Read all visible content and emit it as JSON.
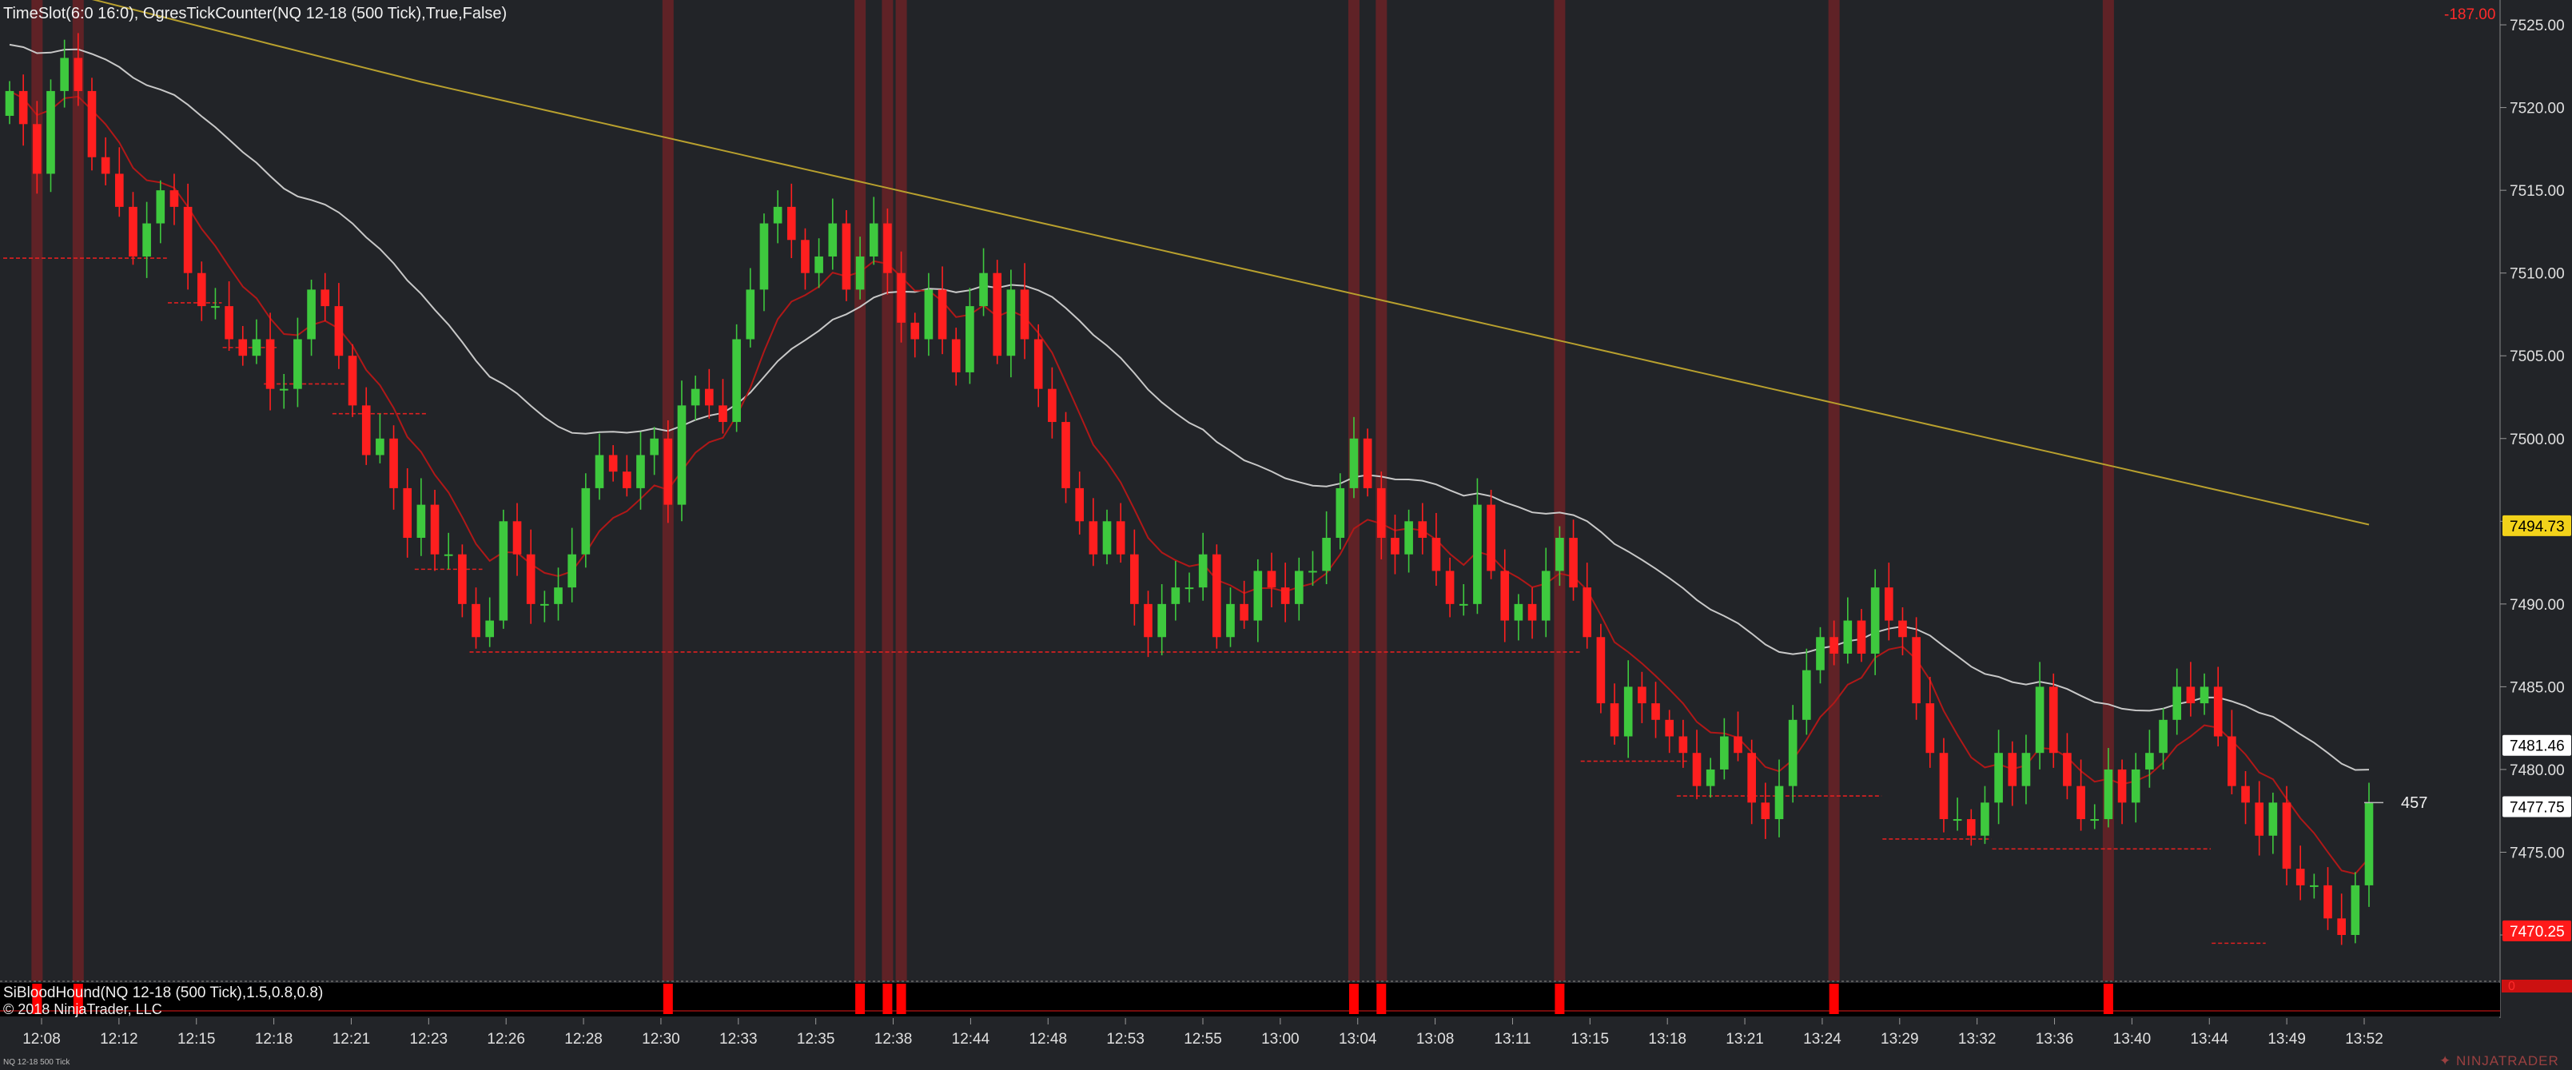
{
  "header": {
    "indicator_label": "TimeSlot(6:0    16:0), OgresTickCounter(NQ 12-18 (500 Tick),True,False)",
    "pnl": "-187.00",
    "tick_counter": "457"
  },
  "sub_panel": {
    "label": "SiBloodHound(NQ 12-18 (500 Tick),1.5,0.8,0.8)",
    "copyright": "© 2018 NinjaTrader, LLC",
    "zero_label": "0"
  },
  "footer": {
    "instrument": "NQ 12-18 500 Tick",
    "logo": "NINJATRADER"
  },
  "price_badges": [
    {
      "value": "7494.73",
      "price": 7494.73,
      "bg": "#f2d21a",
      "fg": "#000000"
    },
    {
      "value": "7481.46",
      "price": 7481.46,
      "bg": "#ffffff",
      "fg": "#000000"
    },
    {
      "value": "7477.75",
      "price": 7477.75,
      "bg": "#ffffff",
      "fg": "#000000"
    },
    {
      "value": "7470.25",
      "price": 7470.25,
      "bg": "#ff1a1a",
      "fg": "#ffffff"
    }
  ],
  "colors": {
    "background": "#222428",
    "up_candle": "#3ec93e",
    "down_candle": "#ff1f1f",
    "sma_slow": "#b8a02e",
    "sma_mid": "#c8c8c8",
    "ema_fast": "#b01818",
    "signal_band": "#6a2226",
    "signal_bar": "#ff0000"
  },
  "chart_data": {
    "type": "candlestick",
    "instrument": "NQ 12-18 (500 Tick)",
    "y_ticks": [
      7470.0,
      7475.0,
      7480.0,
      7485.0,
      7490.0,
      7495.0,
      7500.0,
      7505.0,
      7510.0,
      7515.0,
      7520.0,
      7525.0
    ],
    "ylim": [
      7467.2,
      7526.5
    ],
    "x_tick_labels": [
      "12:08",
      "12:12",
      "12:15",
      "12:18",
      "12:21",
      "12:23",
      "12:26",
      "12:28",
      "12:30",
      "12:33",
      "12:35",
      "12:38",
      "12:44",
      "12:48",
      "12:53",
      "12:55",
      "13:00",
      "13:04",
      "13:08",
      "13:11",
      "13:15",
      "13:18",
      "13:21",
      "13:24",
      "13:29",
      "13:32",
      "13:36",
      "13:40",
      "13:44",
      "13:49",
      "13:52"
    ],
    "closes": [
      7521,
      7519,
      7516,
      7521,
      7523,
      7521,
      7517,
      7516,
      7514,
      7511,
      7513,
      7515,
      7514,
      7510,
      7508,
      7508,
      7506,
      7505,
      7506,
      7503,
      7503,
      7506,
      7509,
      7508,
      7505,
      7502,
      7499,
      7500,
      7497,
      7494,
      7496,
      7493,
      7493,
      7490,
      7488,
      7489,
      7495,
      7493,
      7490,
      7490,
      7491,
      7493,
      7497,
      7499,
      7498,
      7497,
      7499,
      7500,
      7496,
      7502,
      7503,
      7502,
      7501,
      7506,
      7509,
      7513,
      7514,
      7512,
      7510,
      7511,
      7513,
      7509,
      7511,
      7513,
      7510,
      7507,
      7506,
      7509,
      7506,
      7504,
      7508,
      7510,
      7505,
      7509,
      7506,
      7503,
      7501,
      7497,
      7495,
      7493,
      7495,
      7493,
      7490,
      7488,
      7490,
      7491,
      7491,
      7493,
      7488,
      7490,
      7489,
      7492,
      7491,
      7490,
      7492,
      7492,
      7494,
      7497,
      7500,
      7497,
      7494,
      7493,
      7495,
      7494,
      7492,
      7490,
      7490,
      7496,
      7492,
      7489,
      7490,
      7489,
      7492,
      7494,
      7491,
      7488,
      7484,
      7482,
      7485,
      7484,
      7483,
      7482,
      7481,
      7479,
      7480,
      7482,
      7481,
      7478,
      7477,
      7479,
      7483,
      7486,
      7488,
      7487,
      7489,
      7487,
      7491,
      7489,
      7488,
      7484,
      7481,
      7477,
      7477,
      7476,
      7478,
      7481,
      7479,
      7481,
      7485,
      7481,
      7479,
      7477,
      7477,
      7480,
      7478,
      7480,
      7481,
      7483,
      7485,
      7484,
      7485,
      7482,
      7479,
      7478,
      7476,
      7478,
      7474,
      7473,
      7473,
      7471,
      7470,
      7473,
      7478
    ],
    "n_bars": 179,
    "series": [
      {
        "name": "",
        "role": "slow average",
        "color": "#b8a02e"
      },
      {
        "name": "",
        "role": "mid average",
        "color": "#c8c8c8"
      },
      {
        "name": "",
        "role": "fast average",
        "color": "#b01818"
      }
    ],
    "signal_bars_x": [
      2,
      5,
      48,
      62,
      64,
      65,
      98,
      100,
      113,
      133,
      153
    ],
    "support_levels": [
      {
        "price": 7510.9,
        "from": 0,
        "to": 11
      },
      {
        "price": 7508.2,
        "from": 12,
        "to": 15
      },
      {
        "price": 7505.5,
        "from": 16,
        "to": 19
      },
      {
        "price": 7503.3,
        "from": 19,
        "to": 24
      },
      {
        "price": 7501.5,
        "from": 24,
        "to": 30
      },
      {
        "price": 7492.1,
        "from": 30,
        "to": 34
      },
      {
        "price": 7487.1,
        "from": 34,
        "to": 114
      },
      {
        "price": 7480.5,
        "from": 115,
        "to": 122
      },
      {
        "price": 7478.4,
        "from": 122,
        "to": 136
      },
      {
        "price": 7475.8,
        "from": 137,
        "to": 144
      },
      {
        "price": 7475.2,
        "from": 145,
        "to": 160
      },
      {
        "price": 7469.5,
        "from": 161,
        "to": 164
      }
    ]
  }
}
